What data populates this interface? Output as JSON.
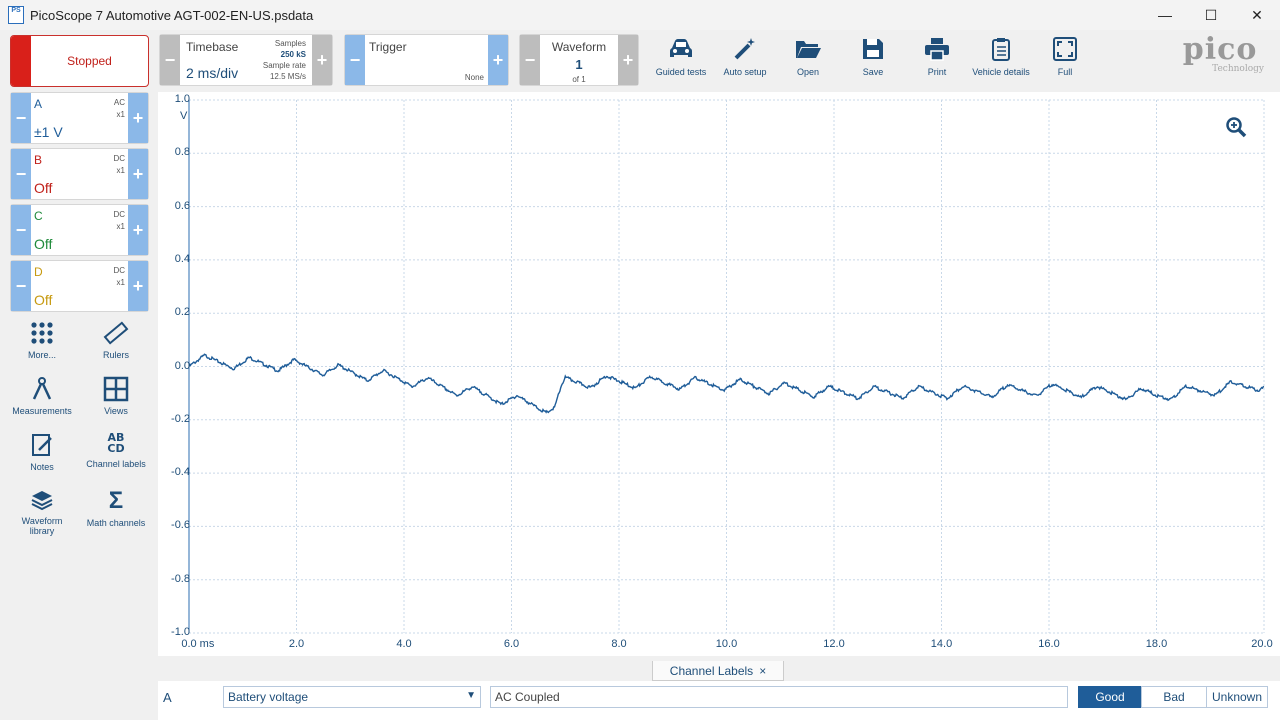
{
  "window": {
    "app_icon_text": "PS",
    "title": "PicoScope 7 Automotive AGT-002-EN-US.psdata",
    "minimize": "—",
    "maximize": "☐",
    "close": "✕"
  },
  "run_control": {
    "label": "Stopped"
  },
  "timebase": {
    "label": "Timebase",
    "value": "2 ms/div",
    "samples_label": "Samples",
    "samples_value": "250 kS",
    "sample_rate_label": "Sample rate",
    "sample_rate_value": "12.5 MS/s",
    "minus": "−",
    "plus": "+"
  },
  "trigger": {
    "label": "Trigger",
    "mode": "None",
    "minus": "−",
    "plus": "+"
  },
  "waveform": {
    "label": "Waveform",
    "current": "1",
    "of_total": "of 1",
    "minus": "−",
    "plus": "+"
  },
  "toolbar": {
    "guided_tests": "Guided tests",
    "auto_setup": "Auto setup",
    "open": "Open",
    "save": "Save",
    "print": "Print",
    "vehicle_details": "Vehicle details",
    "full": "Full"
  },
  "logo": {
    "name": "pico",
    "sub": "Technology"
  },
  "channels": [
    {
      "letter": "A",
      "coupling": "AC",
      "probe": "x1",
      "range": "±1 V",
      "color": "#1f5d99"
    },
    {
      "letter": "B",
      "coupling": "DC",
      "probe": "x1",
      "range": "Off",
      "color": "#c0201a"
    },
    {
      "letter": "C",
      "coupling": "DC",
      "probe": "x1",
      "range": "Off",
      "color": "#1e8a3a"
    },
    {
      "letter": "D",
      "coupling": "DC",
      "probe": "x1",
      "range": "Off",
      "color": "#c79a10"
    }
  ],
  "side_tools": {
    "more": "More...",
    "rulers": "Rulers",
    "measurements": "Measurements",
    "views": "Views",
    "notes": "Notes",
    "channel_labels": "Channel labels",
    "waveform_library": "Waveform library",
    "math_channels": "Math channels"
  },
  "scope": {
    "y_unit": "V",
    "y_ticks": [
      "1.0",
      "0.8",
      "0.6",
      "0.4",
      "0.2",
      "0.0",
      "-0.2",
      "-0.4",
      "-0.6",
      "-0.8",
      "-1.0"
    ],
    "x_ticks": [
      "0.0",
      "2.0",
      "4.0",
      "6.0",
      "8.0",
      "10.0",
      "12.0",
      "14.0",
      "16.0",
      "18.0",
      "20.0"
    ],
    "x_unit": "ms",
    "grid_color": "#c9d8e8",
    "trace_color": "#1f5d99",
    "x_range_ms": [
      0,
      20
    ],
    "y_range_v": [
      -1,
      1
    ]
  },
  "channel_labels_panel": {
    "tab": "Channel Labels",
    "close": "×",
    "channel": "A",
    "label_value": "Battery voltage",
    "notes_value": "AC Coupled",
    "good": "Good",
    "bad": "Bad",
    "unknown": "Unknown"
  }
}
